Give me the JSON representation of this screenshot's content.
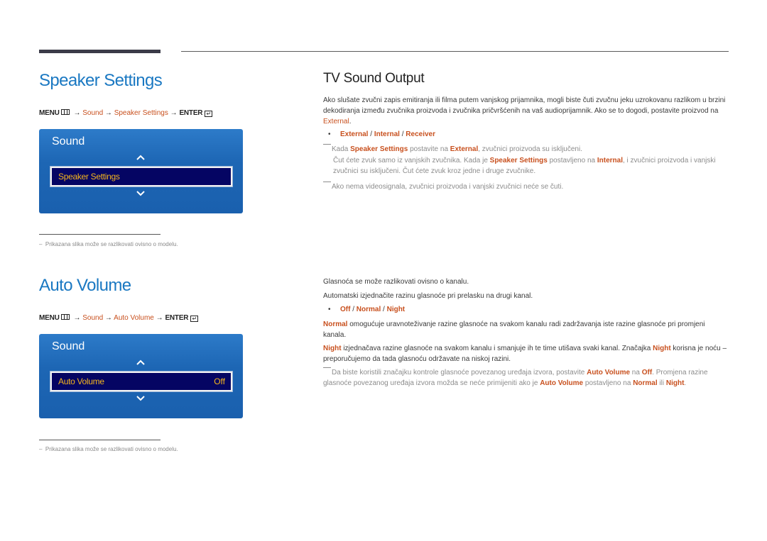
{
  "decor": {
    "accent_blue": "#1a78c2",
    "accent_orange": "#c8501e",
    "osd_blue": "#1d66b4",
    "osd_selected": "#050563",
    "osd_text": "#f5b51e"
  },
  "speaker_settings": {
    "title": "Speaker Settings",
    "path": {
      "menu": "MENU",
      "arrow": "→",
      "step1": "Sound",
      "step2": "Speaker Settings",
      "enter": "ENTER"
    },
    "osd": {
      "title": "Sound",
      "selected_item": "Speaker Settings",
      "up_icon": "chevron-up",
      "down_icon": "chevron-down"
    },
    "footnote": "Prikazana slika može se razlikovati ovisno o modelu."
  },
  "tv_sound_output": {
    "title": "TV Sound Output",
    "intro": {
      "text1": "Ako slušate zvučni zapis emitiranja ili filma putem vanjskog prijamnika, mogli biste čuti zvučnu jeku uzrokovanu razlikom u brzini dekodiranja između zvučnika proizvoda i zvučnika pričvršćenih na vaš audioprijamnik. Ako se to dogodi, postavite proizvod na ",
      "hl1": "External",
      "text2": "."
    },
    "options": [
      "External",
      "Internal",
      "Receiver"
    ],
    "note1": {
      "t1": "Kada ",
      "h1": "Speaker Settings",
      "t2": " postavite na ",
      "h2": "External",
      "t3": ", zvučnici proizvoda su isključeni."
    },
    "note1b": {
      "t1": "Čut ćete zvuk samo iz vanjskih zvučnika. Kada je ",
      "h1": "Speaker Settings",
      "t2": " postavljeno na ",
      "h2": "Internal",
      "t3": ", i zvučnici proizvoda i vanjski zvučnici su isključeni. Čut ćete zvuk kroz jedne i druge zvučnike."
    },
    "note2": "Ako nema videosignala, zvučnici proizvoda i vanjski zvučnici neće se čuti."
  },
  "auto_volume": {
    "title": "Auto Volume",
    "path": {
      "menu": "MENU",
      "arrow": "→",
      "step1": "Sound",
      "step2": "Auto Volume",
      "enter": "ENTER"
    },
    "osd": {
      "title": "Sound",
      "selected_item": "Auto Volume",
      "selected_value": "Off",
      "up_icon": "chevron-up",
      "down_icon": "chevron-down"
    },
    "footnote": "Prikazana slika može se razlikovati ovisno o modelu.",
    "desc1": "Glasnoća se može razlikovati ovisno o kanalu.",
    "desc2": "Automatski izjednačite razinu glasnoće pri prelasku na drugi kanal.",
    "options": [
      "Off",
      "Normal",
      "Night"
    ],
    "normal": {
      "h": "Normal",
      "t": " omogućuje uravnoteživanje razine glasnoće na svakom kanalu radi zadržavanja iste razine glasnoće pri promjeni kanala."
    },
    "night": {
      "h1": "Night",
      "t1": " izjednačava razine glasnoće na svakom kanalu i smanjuje ih te time utišava svaki kanal. Značajka ",
      "h2": "Night",
      "t2": " korisna je noću – preporučujemo da tada glasnoću održavate na niskoj razini."
    },
    "note": {
      "t1": "Da biste koristili značajku kontrole glasnoće povezanog uređaja izvora, postavite ",
      "h1": "Auto Volume",
      "t2": " na ",
      "h2": "Off",
      "t3": ". Promjena razine glasnoće povezanog uređaja izvora možda se neće primijeniti ako je ",
      "h3": "Auto Volume",
      "t4": " postavljeno na ",
      "h4": "Normal",
      "t5": " ili ",
      "h5": "Night",
      "t6": "."
    }
  }
}
